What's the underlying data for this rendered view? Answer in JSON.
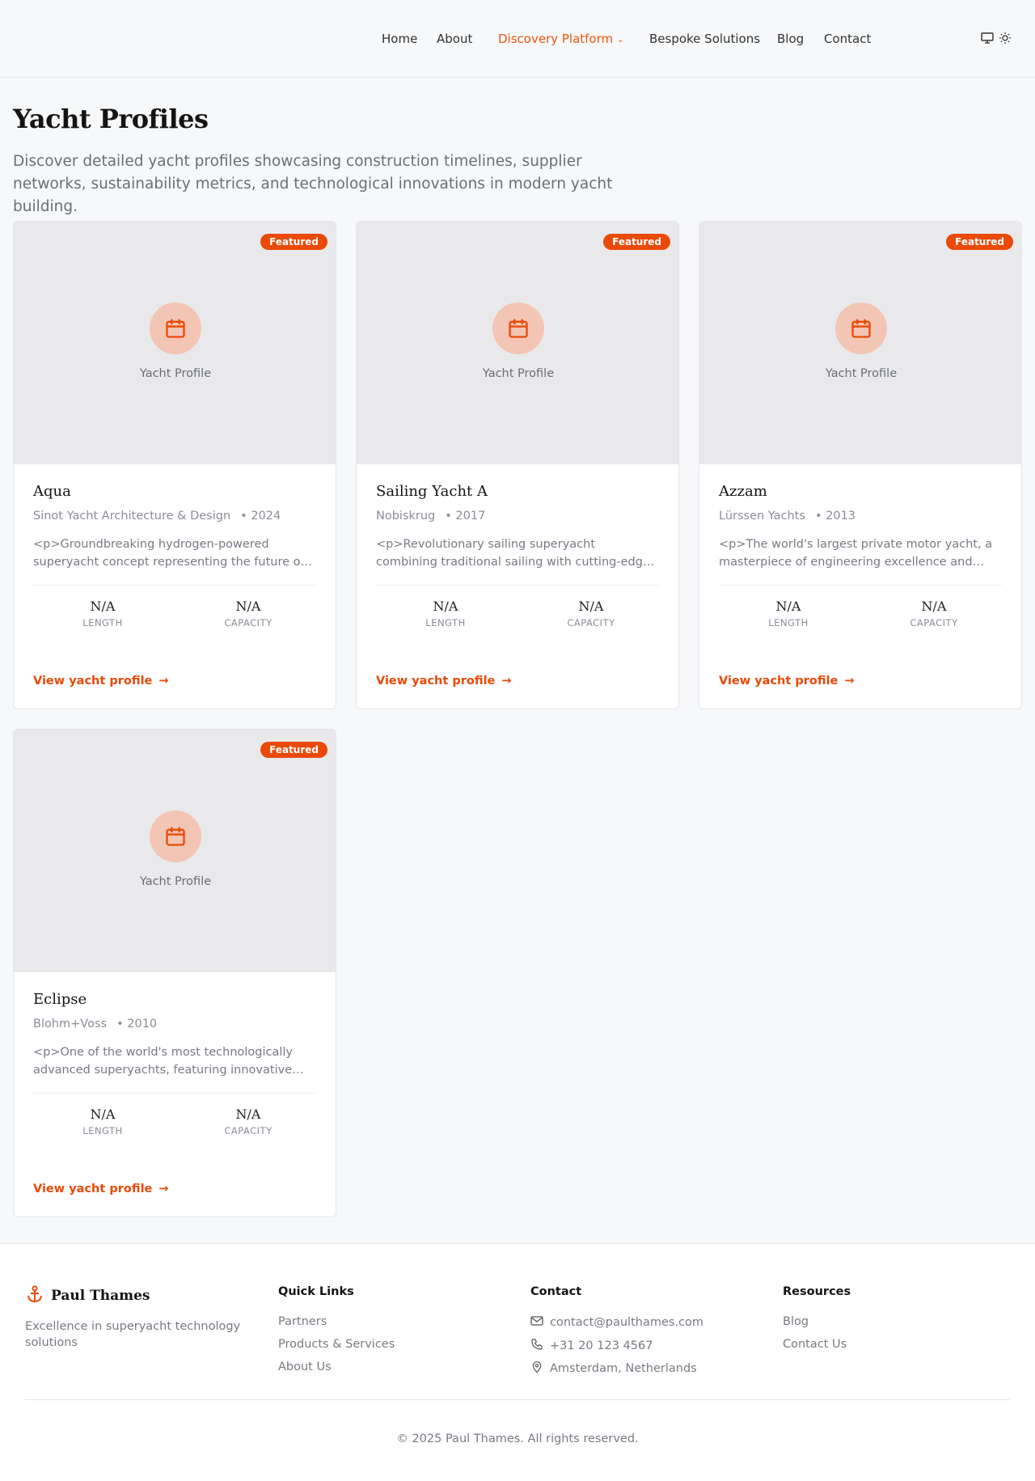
{
  "nav": {
    "items": [
      {
        "label": "Home"
      },
      {
        "label": "About"
      },
      {
        "label": "Discovery Platform",
        "active": true
      },
      {
        "label": "Bespoke Solutions"
      },
      {
        "label": "Blog"
      },
      {
        "label": "Contact"
      }
    ],
    "icons": [
      "monitor-icon",
      "sun-icon"
    ]
  },
  "page": {
    "title": "Yacht Profiles",
    "intro": "Discover detailed yacht profiles showcasing construction timelines, supplier networks, sustainability metrics, and technological innovations in modern yacht building."
  },
  "cards": [
    {
      "badge": "Featured",
      "media_label": "Yacht Profile",
      "name": "Aqua",
      "builder": "Sinot Yacht Architecture & Design",
      "year": "• 2024",
      "description": "<p>Groundbreaking hydrogen-powered superyacht concept representing the future of sustainable yachting.",
      "stats": [
        {
          "value": "N/A",
          "label": "LENGTH"
        },
        {
          "value": "N/A",
          "label": "CAPACITY"
        }
      ],
      "link": "View yacht profile"
    },
    {
      "badge": "Featured",
      "media_label": "Yacht Profile",
      "name": "Sailing Yacht A",
      "builder": "Nobiskrug",
      "year": "• 2017",
      "description": "<p>Revolutionary sailing superyacht combining traditional sailing with cutting-edge technology and design.",
      "stats": [
        {
          "value": "N/A",
          "label": "LENGTH"
        },
        {
          "value": "N/A",
          "label": "CAPACITY"
        }
      ],
      "link": "View yacht profile"
    },
    {
      "badge": "Featured",
      "media_label": "Yacht Profile",
      "name": "Azzam",
      "builder": "Lürssen Yachts",
      "year": "• 2013",
      "description": "<p>The world's largest private motor yacht, a masterpiece of engineering excellence and luxury design.",
      "stats": [
        {
          "value": "N/A",
          "label": "LENGTH"
        },
        {
          "value": "N/A",
          "label": "CAPACITY"
        }
      ],
      "link": "View yacht profile"
    },
    {
      "badge": "Featured",
      "media_label": "Yacht Profile",
      "name": "Eclipse",
      "builder": "Blohm+Voss",
      "year": "• 2010",
      "description": "<p>One of the world's most technologically advanced superyachts, featuring innovative security systems.",
      "stats": [
        {
          "value": "N/A",
          "label": "LENGTH"
        },
        {
          "value": "N/A",
          "label": "CAPACITY"
        }
      ],
      "link": "View yacht profile"
    }
  ],
  "footer": {
    "brand": "Paul Thames",
    "tagline": "Excellence in superyacht technology solutions",
    "quick_links": {
      "title": "Quick Links",
      "items": [
        "Partners",
        "Products & Services",
        "About Us"
      ]
    },
    "contact": {
      "title": "Contact",
      "email": "contact@paulthames.com",
      "phone": "+31 20 123 4567",
      "location": "Amsterdam, Netherlands"
    },
    "resources": {
      "title": "Resources",
      "items": [
        "Blog",
        "Contact Us"
      ]
    },
    "copyright": "© 2025 Paul Thames. All rights reserved."
  },
  "colors": {
    "accent": "#ea4a08",
    "background": "#f7f8fa"
  }
}
